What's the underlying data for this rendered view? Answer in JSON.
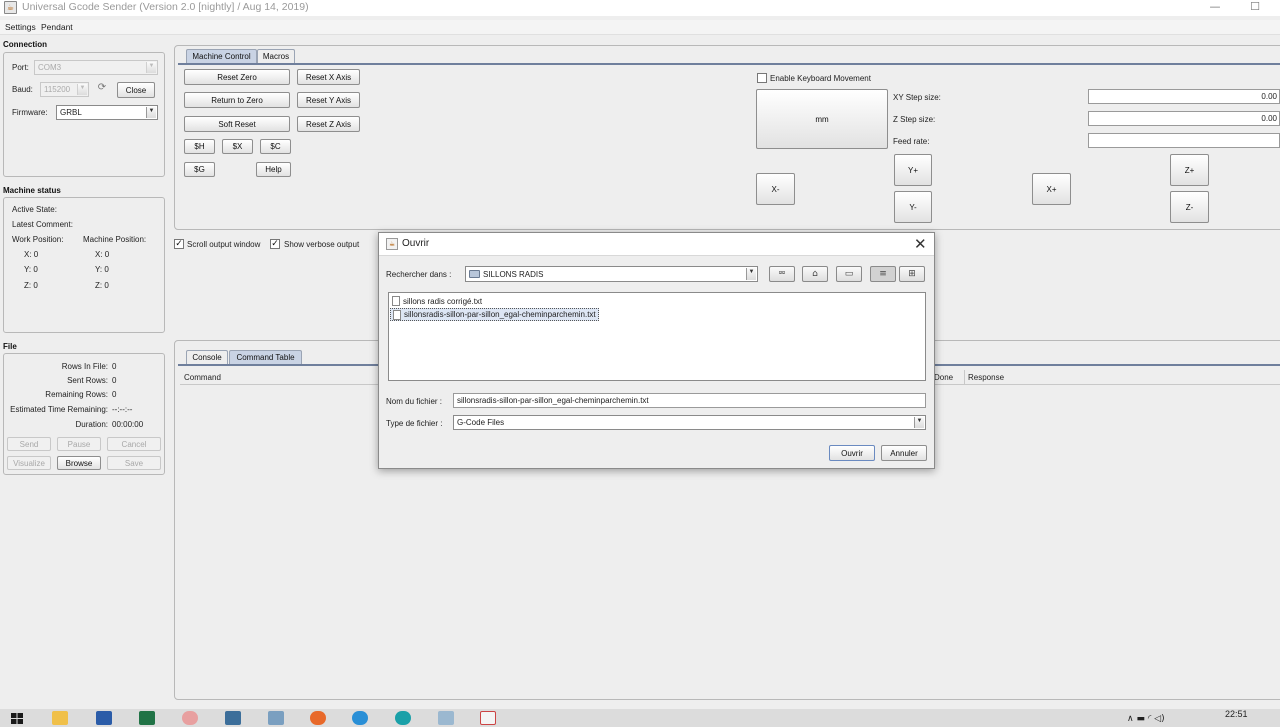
{
  "window": {
    "title": "Universal Gcode Sender (Version 2.0 [nightly]  / Aug 14, 2019)",
    "minimize_glyph": "—",
    "maximize_glyph": "☐"
  },
  "menu": {
    "items": [
      "Settings",
      "Pendant"
    ]
  },
  "connection": {
    "section_title": "Connection",
    "port_label": "Port:",
    "port_value": "COM3",
    "baud_label": "Baud:",
    "baud_value": "115200",
    "close_button": "Close",
    "firmware_label": "Firmware:",
    "firmware_value": "GRBL"
  },
  "machine_status": {
    "section_title": "Machine status",
    "active_state_label": "Active State:",
    "latest_comment_label": "Latest Comment:",
    "work_position_label": "Work Position:",
    "machine_position_label": "Machine Position:",
    "work": {
      "x": "X:  0",
      "y": "Y:  0",
      "z": "Z:  0"
    },
    "machine": {
      "x": "X:  0",
      "y": "Y:  0",
      "z": "Z:  0"
    }
  },
  "file": {
    "section_title": "File",
    "rows_in_file_label": "Rows In File:",
    "rows_in_file_value": "0",
    "sent_rows_label": "Sent Rows:",
    "sent_rows_value": "0",
    "remaining_rows_label": "Remaining Rows:",
    "remaining_rows_value": "0",
    "estimated_time_label": "Estimated Time Remaining:",
    "estimated_time_value": "--:--:--",
    "duration_label": "Duration:",
    "duration_value": "00:00:00",
    "send_button": "Send",
    "pause_button": "Pause",
    "cancel_button": "Cancel",
    "visualize_button": "Visualize",
    "browse_button": "Browse",
    "save_button": "Save"
  },
  "machine_control": {
    "tabs": [
      "Machine Control",
      "Macros"
    ],
    "reset_zero": "Reset Zero",
    "return_to_zero": "Return to Zero",
    "soft_reset": "Soft Reset",
    "reset_x": "Reset X Axis",
    "reset_y": "Reset Y Axis",
    "reset_z": "Reset Z Axis",
    "cmd_h": "$H",
    "cmd_x": "$X",
    "cmd_c": "$C",
    "cmd_g": "$G",
    "help": "Help",
    "keyboard_label": "Enable Keyboard Movement",
    "units_button": "mm",
    "xy_step_label": "XY Step size:",
    "xy_step_value": "0.00",
    "z_step_label": "Z Step size:",
    "z_step_value": "0.00",
    "feed_rate_label": "Feed rate:",
    "feed_rate_value": "",
    "jog": {
      "y_plus": "Y+",
      "y_minus": "Y-",
      "x_minus": "X-",
      "x_plus": "X+",
      "z_plus": "Z+",
      "z_minus": "Z-"
    }
  },
  "output": {
    "scroll_label": "Scroll output window",
    "verbose_label": "Show verbose output",
    "tabs": [
      "Console",
      "Command Table"
    ],
    "columns": [
      "Command",
      "Done",
      "Response"
    ]
  },
  "dialog": {
    "title": "Ouvrir",
    "look_in_label": "Rechercher dans :",
    "look_in_value": "SILLONS RADIS",
    "toolbar_icons": [
      "up-folder-icon",
      "home-icon",
      "new-folder-icon",
      "list-view-icon",
      "details-view-icon"
    ],
    "files": [
      {
        "name": "sillons radis corrigé.txt",
        "selected": false
      },
      {
        "name": "sillonsradis-sillon-par-sillon_egal-cheminparchemin.txt",
        "selected": true
      }
    ],
    "filename_label": "Nom du fichier :",
    "filename_value": "sillonsradis-sillon-par-sillon_egal-cheminparchemin.txt",
    "filetype_label": "Type de fichier :",
    "filetype_value": "G-Code Files",
    "open_button": "Ouvrir",
    "cancel_button": "Annuler"
  },
  "taskbar": {
    "time": "22:51",
    "icons": [
      "windows-start-icon",
      "file-explorer-icon",
      "word-icon",
      "excel-icon",
      "paint-icon",
      "calculator-icon",
      "pen-icon",
      "firefox-icon",
      "edge-icon",
      "arduino-icon",
      "notepad-icon",
      "java-app-icon"
    ],
    "tray_glyphs": "∧  ▬  ◜  ◁)"
  },
  "colors": {
    "tab_active": "#c9d3e4",
    "tab_line": "#6f7f9c",
    "selection": "#dde6f4"
  }
}
